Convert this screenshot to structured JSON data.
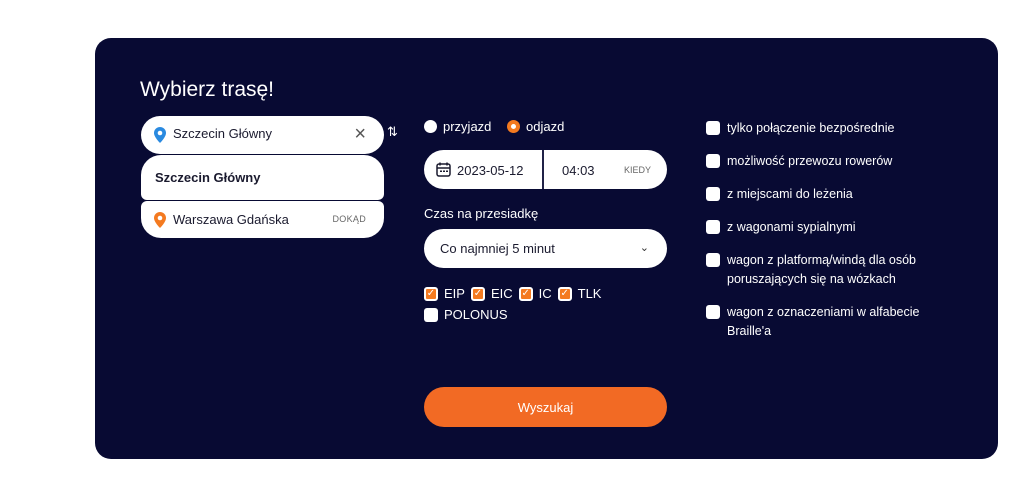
{
  "panel": {
    "title": "Wybierz trasę!",
    "from": {
      "value": "Szczecin Główny",
      "icon": "location-pin-icon",
      "color": "#2a8ae0"
    },
    "suggestion": "Szczecin Główny",
    "to": {
      "value": "Warszawa Gdańska",
      "tag": "DOKĄD",
      "color": "#f47a20"
    },
    "mode": {
      "arrival": "przyjazd",
      "departure": "odjazd",
      "selected": "odjazd"
    },
    "date": "2023-05-12",
    "time": "04:03",
    "when_tag": "KIEDY",
    "transfer_label": "Czas na przesiadkę",
    "transfer_value": "Co najmniej 5 minut",
    "train_types": [
      {
        "label": "EIP",
        "checked": true
      },
      {
        "label": "EIC",
        "checked": true
      },
      {
        "label": "IC",
        "checked": true
      },
      {
        "label": "TLK",
        "checked": true
      },
      {
        "label": "POLONUS",
        "checked": false
      }
    ],
    "options": [
      "tylko połączenie bezpośrednie",
      "możliwość przewozu rowerów",
      "z miejscami do leżenia",
      "z wagonami sypialnymi",
      "wagon z platformą/windą dla osób poruszających się na wózkach",
      "wagon z oznaczeniami w alfabecie Braille'a"
    ],
    "search_label": "Wyszukaj",
    "accent": "#f26a24",
    "background": "#080a33"
  }
}
